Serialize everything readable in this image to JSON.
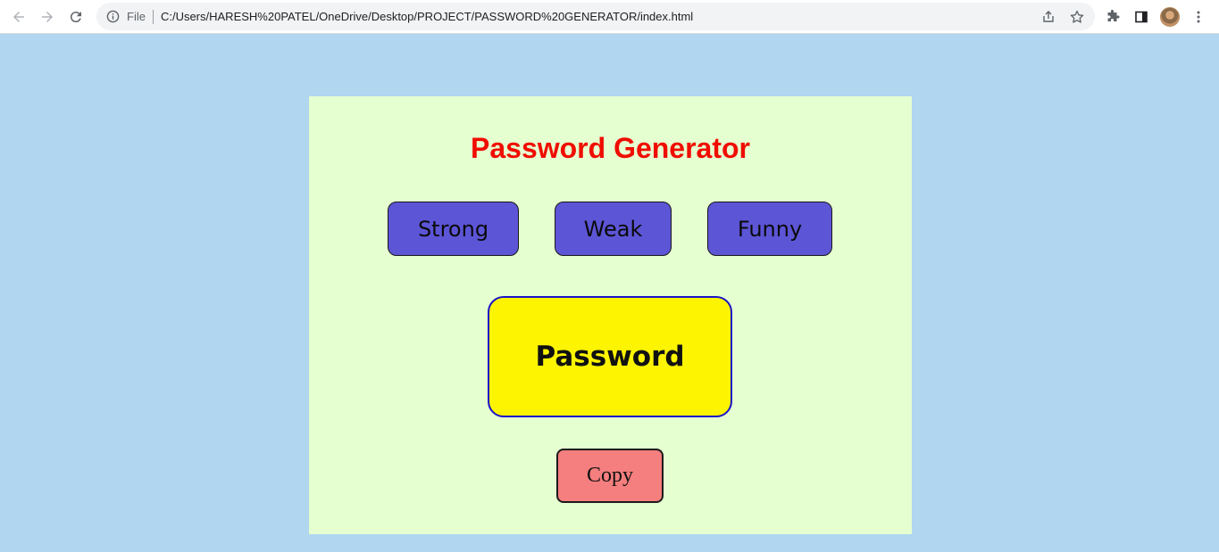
{
  "browser": {
    "address_prefix": "File",
    "url": "C:/Users/HARESH%20PATEL/OneDrive/Desktop/PROJECT/PASSWORD%20GENERATOR/index.html"
  },
  "page": {
    "title": "Password Generator",
    "options": {
      "strong_label": "Strong",
      "weak_label": "Weak",
      "funny_label": "Funny"
    },
    "password_display": "Password",
    "copy_label": "Copy"
  },
  "colors": {
    "page_background": "#b0d6f0",
    "card_background": "#e6ffd1",
    "title": "#f00d00",
    "option_button": "#5c55d6",
    "password_box": "#fcf400",
    "password_border": "#1a14c8",
    "copy_button": "#f57e7e"
  },
  "icons": [
    "back-arrow-icon",
    "forward-arrow-icon",
    "reload-icon",
    "info-icon",
    "share-icon",
    "star-icon",
    "extensions-icon",
    "side-panel-icon",
    "profile-avatar",
    "more-menu-icon"
  ]
}
